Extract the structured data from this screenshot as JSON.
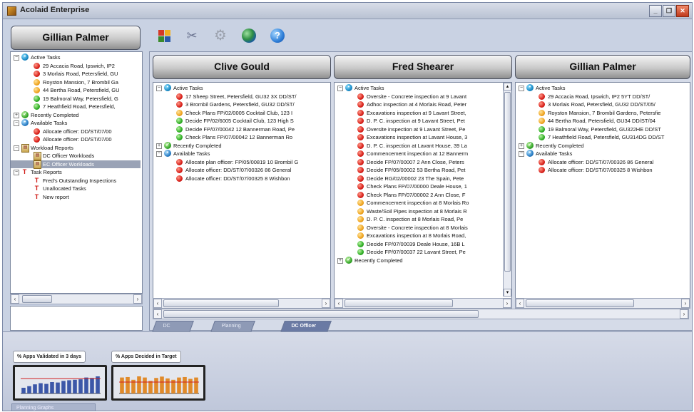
{
  "window": {
    "title": "Acolaid Enterprise",
    "minimize": "_",
    "restore": "❐",
    "close": "✕"
  },
  "left": {
    "user": "Gillian Palmer",
    "tree": [
      {
        "kind": "group",
        "icon": "active",
        "toggle": "−",
        "label": "Active Tasks",
        "level": 0
      },
      {
        "kind": "item",
        "icon": "red",
        "label": "29 Accacia Road, Ipswich, IP2",
        "level": 1
      },
      {
        "kind": "item",
        "icon": "red",
        "label": "3 Morlais Road, Petersfield, GU",
        "level": 1
      },
      {
        "kind": "item",
        "icon": "amber",
        "label": "Royston Mansion, 7 Brombil Ga",
        "level": 1
      },
      {
        "kind": "item",
        "icon": "amber",
        "label": "44 Bertha Road, Petersfield, GU",
        "level": 1
      },
      {
        "kind": "item",
        "icon": "green",
        "label": "19 Balmoral Way, Petersfield, G",
        "level": 1
      },
      {
        "kind": "item",
        "icon": "green",
        "label": "7 Heathfield Road, Petersfield,",
        "level": 1
      },
      {
        "kind": "group",
        "icon": "done",
        "toggle": "+",
        "label": "Recently Completed",
        "level": 0
      },
      {
        "kind": "group",
        "icon": "avail",
        "toggle": "−",
        "label": "Available Tasks",
        "level": 0
      },
      {
        "kind": "item",
        "icon": "red",
        "label": "Allocate officer: DD/ST/07/00",
        "level": 1
      },
      {
        "kind": "item",
        "icon": "red",
        "label": "Allocate officer: DD/ST/07/00",
        "level": 1
      },
      {
        "kind": "group",
        "icon": "report",
        "toggle": "−",
        "label": "Workload Reports",
        "level": 0
      },
      {
        "kind": "item",
        "icon": "report",
        "label": "DC Officer Workloads",
        "level": 1
      },
      {
        "kind": "item",
        "icon": "report",
        "label": "EC Officer Workloads",
        "level": 1,
        "selected": true
      },
      {
        "kind": "group",
        "icon": "task",
        "toggle": "−",
        "label": "Task Reports",
        "level": 0
      },
      {
        "kind": "item",
        "icon": "task",
        "label": "Fred's Outstanding Inspections",
        "level": 1
      },
      {
        "kind": "item",
        "icon": "task",
        "label": "Unallocated Tasks",
        "level": 1
      },
      {
        "kind": "item",
        "icon": "task",
        "label": "New report",
        "level": 1
      }
    ]
  },
  "toolbar": {
    "icons": [
      "cube-icon",
      "tools-icon",
      "gear-icon",
      "globe-icon",
      "help-icon"
    ],
    "help_glyph": "?"
  },
  "columns": [
    {
      "user": "Clive Gould",
      "tree": [
        {
          "kind": "group",
          "icon": "active",
          "toggle": "−",
          "label": "Active Tasks",
          "level": 0
        },
        {
          "kind": "item",
          "icon": "red",
          "label": "17 Sheep Street, Petersfield, GU32 3X DD/ST/",
          "level": 1
        },
        {
          "kind": "item",
          "icon": "red",
          "label": "3 Brombil Gardens, Petersfield, GU32 DD/ST/",
          "level": 1
        },
        {
          "kind": "item",
          "icon": "amber",
          "label": "Check Plans FP/02/0005 Cocktail Club, 123 I",
          "level": 1
        },
        {
          "kind": "item",
          "icon": "green",
          "label": "Decide FP/02/6005 Cocktail Club, 123 High S",
          "level": 1
        },
        {
          "kind": "item",
          "icon": "green",
          "label": "Decide FP/07/00042 12 Bannerman Road, Pe",
          "level": 1
        },
        {
          "kind": "item",
          "icon": "green",
          "label": "Check Plans FP/07/00042 12 Bannerman Ro",
          "level": 1
        },
        {
          "kind": "group",
          "icon": "done",
          "toggle": "+",
          "label": "Recently Completed",
          "level": 0
        },
        {
          "kind": "group",
          "icon": "avail",
          "toggle": "−",
          "label": "Available Tasks",
          "level": 0
        },
        {
          "kind": "item",
          "icon": "red",
          "label": "Allocate plan officer: FP/05/00819 10 Brombil G",
          "level": 1
        },
        {
          "kind": "item",
          "icon": "red",
          "label": "Allocate officer: DD/ST/07/00326 86 General",
          "level": 1
        },
        {
          "kind": "item",
          "icon": "red",
          "label": "Allocate officer: DD/ST/07/00325 8 Wishbon",
          "level": 1
        }
      ]
    },
    {
      "user": "Fred Shearer",
      "tree": [
        {
          "kind": "group",
          "icon": "active",
          "toggle": "−",
          "label": "Active Tasks",
          "level": 0
        },
        {
          "kind": "item",
          "icon": "red",
          "label": "Oversite - Concrete inspection at 9 Lavant",
          "level": 1
        },
        {
          "kind": "item",
          "icon": "red",
          "label": "Adhoc inspection at 4 Morlais Road, Peter",
          "level": 1
        },
        {
          "kind": "item",
          "icon": "red",
          "label": "Excavations inspection at 9 Lavant Street,",
          "level": 1
        },
        {
          "kind": "item",
          "icon": "red",
          "label": "D. P. C. inspection at 9 Lavant Street, Pet",
          "level": 1
        },
        {
          "kind": "item",
          "icon": "red",
          "label": "Oversite inspection at 9 Lavant Street, Pe",
          "level": 1
        },
        {
          "kind": "item",
          "icon": "red",
          "label": "Excavations inspection at Lavant House, 3",
          "level": 1
        },
        {
          "kind": "item",
          "icon": "red",
          "label": "D. P. C. inspection at Lavant House, 39 La",
          "level": 1
        },
        {
          "kind": "item",
          "icon": "red",
          "label": "Commencement inspection at 12 Bannerm",
          "level": 1
        },
        {
          "kind": "item",
          "icon": "red",
          "label": "Decide FP/07/00007 2 Ann Close, Peters",
          "level": 1
        },
        {
          "kind": "item",
          "icon": "red",
          "label": "Decide FP/05/00002 53 Bertha Road, Pet",
          "level": 1
        },
        {
          "kind": "item",
          "icon": "red",
          "label": "Decide RG/02/00002 23 The Spain, Pete",
          "level": 1
        },
        {
          "kind": "item",
          "icon": "red",
          "label": "Check Plans FP/07/00000 Deale House, 1",
          "level": 1
        },
        {
          "kind": "item",
          "icon": "red",
          "label": "Check Plans FP/07/00002 2 Ann Close, F",
          "level": 1
        },
        {
          "kind": "item",
          "icon": "amber",
          "label": "Commencement inspection at 8 Morlais Ro",
          "level": 1
        },
        {
          "kind": "item",
          "icon": "amber",
          "label": "Waste/Soil Pipes inspection at 8 Morlais R",
          "level": 1
        },
        {
          "kind": "item",
          "icon": "amber",
          "label": "D. P. C. inspection at 8 Morlais Road, Pe",
          "level": 1
        },
        {
          "kind": "item",
          "icon": "amber",
          "label": "Oversite - Concrete inspection at 8 Morlais",
          "level": 1
        },
        {
          "kind": "item",
          "icon": "amber",
          "label": "Excavations inspection at 8 Morlais Road,",
          "level": 1
        },
        {
          "kind": "item",
          "icon": "green",
          "label": "Decide FP/07/00039 Deale House, 16B L",
          "level": 1
        },
        {
          "kind": "item",
          "icon": "green",
          "label": "Decide FP/07/00037 22 Lavant Street, Pe",
          "level": 1
        },
        {
          "kind": "group",
          "icon": "done",
          "toggle": "+",
          "label": "Recently Completed",
          "level": 0
        }
      ]
    },
    {
      "user": "Gillian Palmer",
      "tree": [
        {
          "kind": "group",
          "icon": "active",
          "toggle": "−",
          "label": "Active Tasks",
          "level": 0
        },
        {
          "kind": "item",
          "icon": "red",
          "label": "29 Accacia Road, Ipswich, IP2 5YT DD/ST/",
          "level": 1
        },
        {
          "kind": "item",
          "icon": "red",
          "label": "3 Morlais Road, Petersfield, GU32 DD/ST/05/",
          "level": 1
        },
        {
          "kind": "item",
          "icon": "amber",
          "label": "Royston Mansion, 7 Brombil Gardens, Petersfie",
          "level": 1
        },
        {
          "kind": "item",
          "icon": "amber",
          "label": "44 Bertha Road, Petersfield, GU34 DD/ST/04",
          "level": 1
        },
        {
          "kind": "item",
          "icon": "green",
          "label": "19 Balmoral Way, Petersfield, GU322HE DD/ST",
          "level": 1
        },
        {
          "kind": "item",
          "icon": "green",
          "label": "7 Heathfield Road, Petersfield, GU314DG DD/ST",
          "level": 1
        },
        {
          "kind": "group",
          "icon": "done",
          "toggle": "+",
          "label": "Recently Completed",
          "level": 0
        },
        {
          "kind": "group",
          "icon": "avail",
          "toggle": "−",
          "label": "Available Tasks",
          "level": 0
        },
        {
          "kind": "item",
          "icon": "red",
          "label": "Allocate officer: DD/ST/07/00326 86 General",
          "level": 1
        },
        {
          "kind": "item",
          "icon": "red",
          "label": "Allocate officer: DD/ST/07/00325 8 Wishbon",
          "level": 1
        }
      ]
    }
  ],
  "tabs": [
    {
      "label": "DC Graphs",
      "active": false
    },
    {
      "label": "Planning Portal",
      "active": false
    },
    {
      "label": "DC Officer Workloads",
      "active": true
    }
  ],
  "kpis": [
    {
      "label": "% Apps Validated in 3 days",
      "values": [
        0.25,
        0.32,
        0.4,
        0.45,
        0.42,
        0.5,
        0.48,
        0.55,
        0.58,
        0.6,
        0.62,
        0.7,
        0.68,
        0.75
      ],
      "target": 0.65,
      "bar_color": "#3c57a8"
    },
    {
      "label": "% Apps Decided in Target",
      "values": [
        0.7,
        0.72,
        0.6,
        0.75,
        0.7,
        0.55,
        0.68,
        0.74,
        0.66,
        0.6,
        0.7,
        0.72,
        0.64,
        0.7
      ],
      "target": 0.5,
      "bar_color": "#e08a2a"
    }
  ],
  "bottom_tab": "Planning Graphs",
  "scroll": {
    "left": "‹",
    "right": "›",
    "up": "▴",
    "down": "▾"
  }
}
